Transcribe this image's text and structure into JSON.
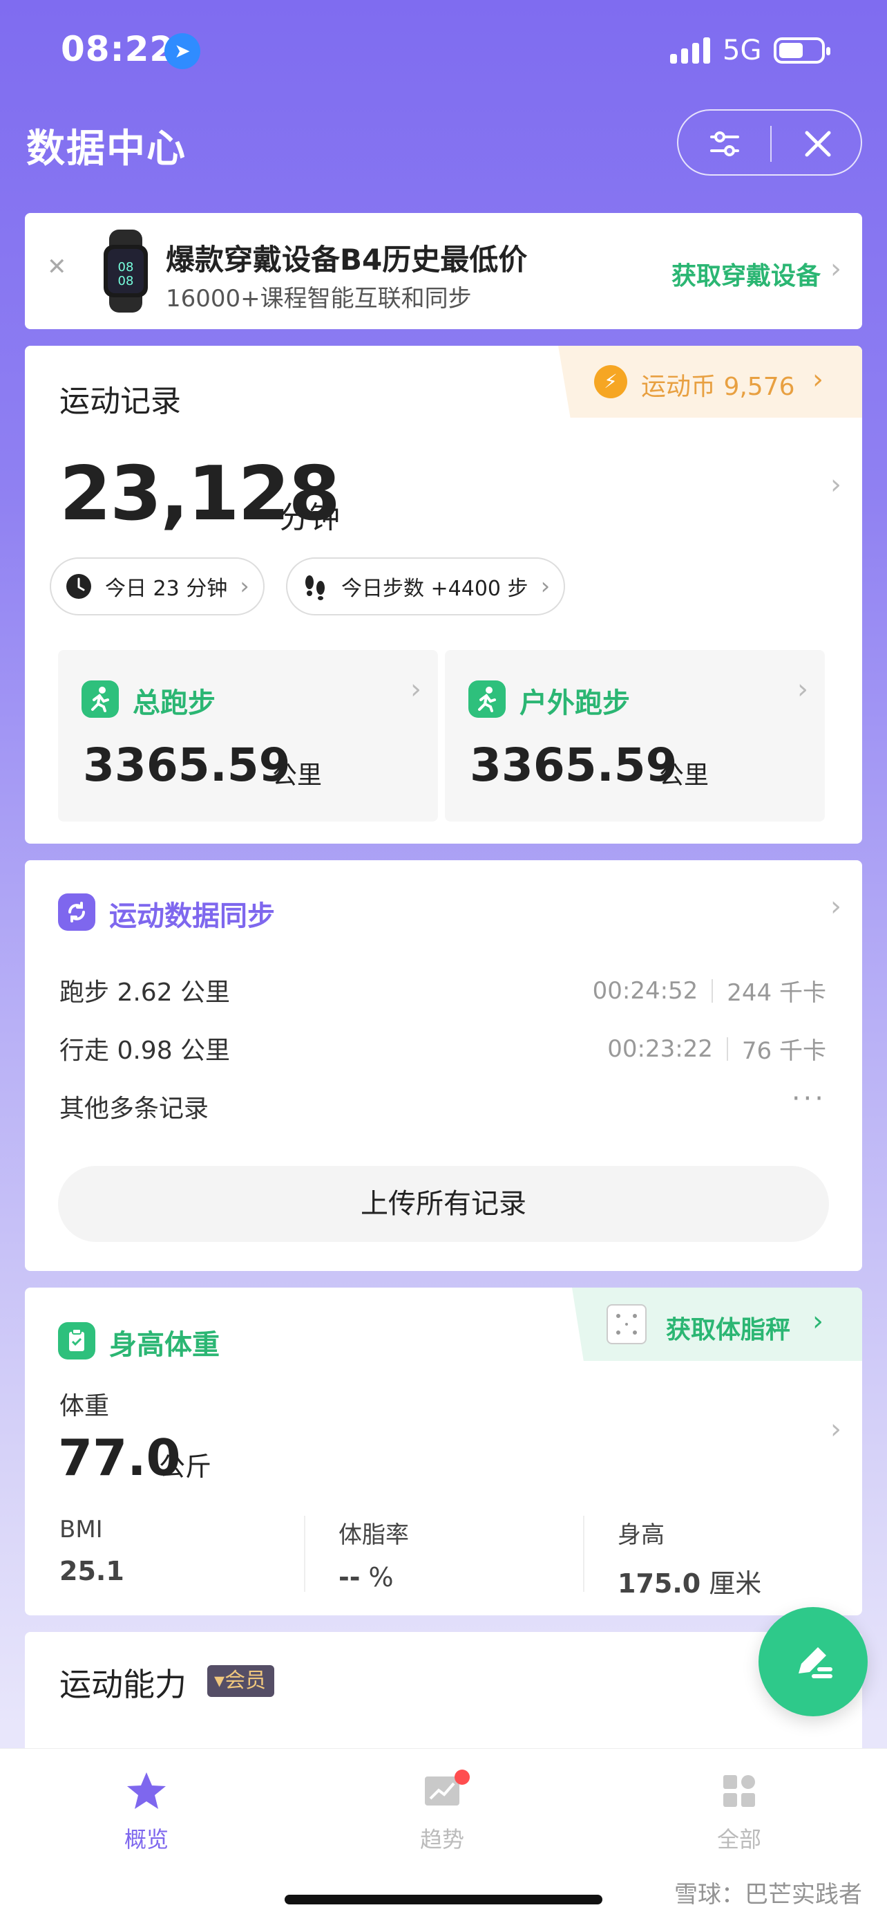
{
  "status_bar": {
    "time": "08:22",
    "network": "5G"
  },
  "header": {
    "title": "数据中心"
  },
  "banner": {
    "title": "爆款穿戴设备B4历史最低价",
    "subtitle": "16000+课程智能互联和同步",
    "cta": "获取穿戴设备"
  },
  "record": {
    "title": "运动记录",
    "coin_label": "运动币 9,576",
    "total_value": "23,128",
    "total_unit": "分钟",
    "today_minutes": "今日 23 分钟",
    "today_steps": "今日步数 +4400 步",
    "boxes": [
      {
        "name": "总跑步",
        "value": "3365.59",
        "unit": "公里"
      },
      {
        "name": "户外跑步",
        "value": "3365.59",
        "unit": "公里"
      }
    ]
  },
  "sync": {
    "title": "运动数据同步",
    "rows": [
      {
        "label": "跑步 2.62 公里",
        "time": "00:24:52",
        "cal": "244 千卡"
      },
      {
        "label": "行走 0.98 公里",
        "time": "00:23:22",
        "cal": "76 千卡"
      }
    ],
    "more": "其他多条记录",
    "upload": "上传所有记录"
  },
  "body": {
    "title": "身高体重",
    "cta": "获取体脂秤",
    "weight_label": "体重",
    "weight_value": "77.0",
    "weight_unit": "公斤",
    "metrics": [
      {
        "key": "BMI",
        "value": "25.1",
        "unit": ""
      },
      {
        "key": "体脂率",
        "value": "--",
        "unit": "%"
      },
      {
        "key": "身高",
        "value": "175.0",
        "unit": "厘米"
      }
    ]
  },
  "ability": {
    "title": "运动能力",
    "vip": "会员"
  },
  "tabs": [
    {
      "label": "概览",
      "icon": "star-icon",
      "active": true
    },
    {
      "label": "趋势",
      "icon": "trend-icon",
      "active": false
    },
    {
      "label": "全部",
      "icon": "grid-icon",
      "active": false
    }
  ],
  "watermark": "雪球：巴芒实践者",
  "colors": {
    "accent_purple": "#7e67ee",
    "accent_green": "#2bb673",
    "coin_orange": "#e8a041"
  }
}
